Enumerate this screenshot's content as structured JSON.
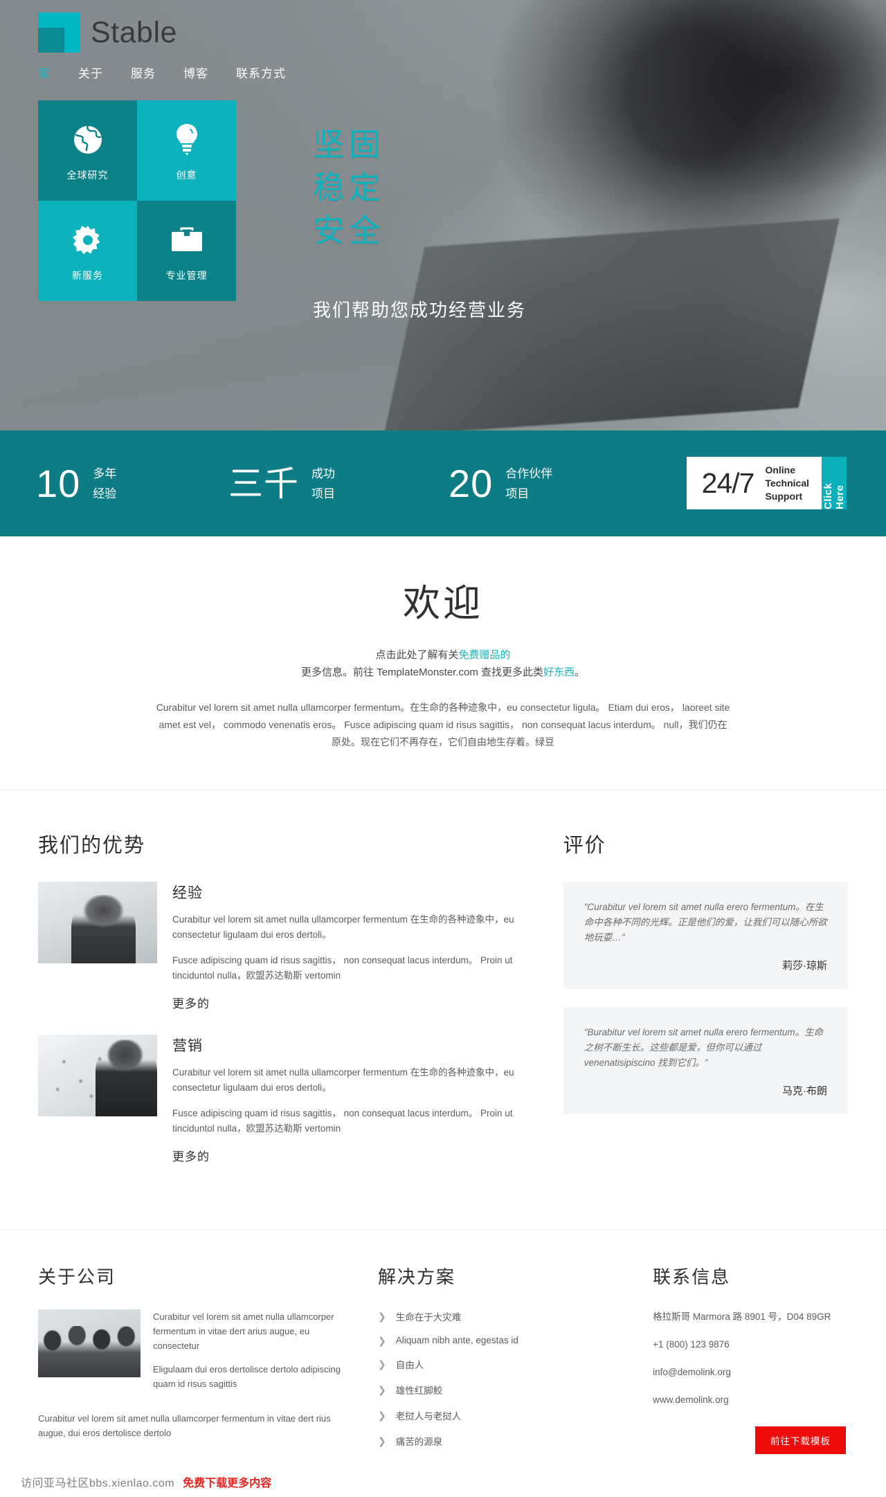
{
  "brand": {
    "name": "Stable"
  },
  "nav": {
    "items": [
      {
        "label": "家",
        "active": true
      },
      {
        "label": "关于",
        "active": false
      },
      {
        "label": "服务",
        "active": false
      },
      {
        "label": "博客",
        "active": false
      },
      {
        "label": "联系方式",
        "active": false
      }
    ]
  },
  "hero": {
    "tiles": [
      {
        "label": "全球研究",
        "icon": "globe-icon",
        "tone": "dark"
      },
      {
        "label": "创意",
        "icon": "lightbulb-icon",
        "tone": "light"
      },
      {
        "label": "新服务",
        "icon": "gear-icon",
        "tone": "light"
      },
      {
        "label": "专业管理",
        "icon": "briefcase-icon",
        "tone": "dark"
      }
    ],
    "headline": [
      "坚固",
      "稳定",
      "安全"
    ],
    "subhead": "我们帮助您成功经营业务"
  },
  "stats": {
    "items": [
      {
        "value": "10",
        "label_1": "多年",
        "label_2": "经验"
      },
      {
        "value": "三千",
        "label_1": "成功",
        "label_2": "项目"
      },
      {
        "value": "20",
        "label_1": "合作伙伴",
        "label_2": "项目"
      }
    ],
    "support": {
      "number": "24/7",
      "lines": [
        "Online",
        "Technical",
        "Support"
      ],
      "cta": "Click Here"
    }
  },
  "welcome": {
    "title": "欢迎",
    "intro_1": "点击此处了解有关",
    "intro_link_1": "免费赠品的",
    "intro_2": "更多信息。前往 TemplateMonster.com 查找更多此类",
    "intro_link_2": "好东西",
    "intro_3": "。",
    "body": "Curabitur vel lorem sit amet nulla ullamcorper fermentum。在生命的各种迹象中，eu consectetur ligula。 Etiam dui eros， laoreet site amet est vel， commodo venenatis eros。 Fusce adipiscing quam id risus sagittis， non consequat lacus interdum。 null，我们仍在原处。现在它们不再存在，它们自由地生存着。绿豆"
  },
  "advantages": {
    "title": "我们的优势",
    "items": [
      {
        "heading": "经验",
        "para_1": "Curabitur vel lorem sit amet nulla ullamcorper fermentum 在生命的各种迹象中，eu consectetur ligulaam dui eros dertoli。",
        "para_2": "Fusce adipiscing quam id risus sagittis， non consequat lacus interdum。 Proin ut tinciduntol nulla，欧盟苏达勒斯 vertomin",
        "more": "更多的"
      },
      {
        "heading": "营销",
        "para_1": "Curabitur vel lorem sit amet nulla ullamcorper fermentum 在生命的各种迹象中，eu consectetur ligulaam dui eros dertoli。",
        "para_2": "Fusce adipiscing quam id risus sagittis， non consequat lacus interdum。 Proin ut tinciduntol nulla，欧盟苏达勒斯 vertomin",
        "more": "更多的"
      }
    ]
  },
  "testimonials": {
    "title": "评价",
    "items": [
      {
        "quote": "\"Curabitur vel lorem sit amet nulla erero fermentum。在生命中各种不同的光辉。正是他们的爱，让我们可以随心所欲地玩耍…\"",
        "author": "莉莎·琼斯"
      },
      {
        "quote": "\"Burabitur vel lorem sit amet nulla erero fermentum。生命之树不断生长。这些都是爱，但你可以通过 venenatisipiscino 找到它们。\"",
        "author": "马克·布朗"
      }
    ]
  },
  "footer": {
    "about": {
      "title": "关于公司",
      "para_1": "Curabitur vel lorem sit amet nulla ullamcorper fermentum in vitae dert arius augue, eu consectetur",
      "para_2": "Eligulaam dui eros dertolisce dertolo adipiscing quam id risus sagittis",
      "para_3": "Curabitur vel lorem sit amet nulla ullamcorper fermentum in vitae dert rius augue, dui eros dertolisce dertolo"
    },
    "solutions": {
      "title": "解决方案",
      "items": [
        "生命在于大灾难",
        "Aliquam nibh ante, egestas id",
        "自由人",
        "雄性红脚鲛",
        "老挝人与老挝人",
        "痛苦的源泉"
      ]
    },
    "contact": {
      "title": "联系信息",
      "address": "格拉斯哥 Marmora 路 8901 号，D04 89GR",
      "phone": "+1 (800) 123 9876",
      "email": "info@demolink.org",
      "website": "www.demolink.org"
    },
    "download_button": "前往下载模板"
  },
  "bottom_bar": {
    "grey_text": "访问亚马社区bbs.xienlao.com",
    "red_text": "免费下载更多内容"
  },
  "colors": {
    "teal_dark": "#0a8288",
    "teal_light": "#0cb3bd",
    "teal_band": "#0d7c85",
    "accent_link": "#17b3bd",
    "red": "#f00b0b"
  }
}
